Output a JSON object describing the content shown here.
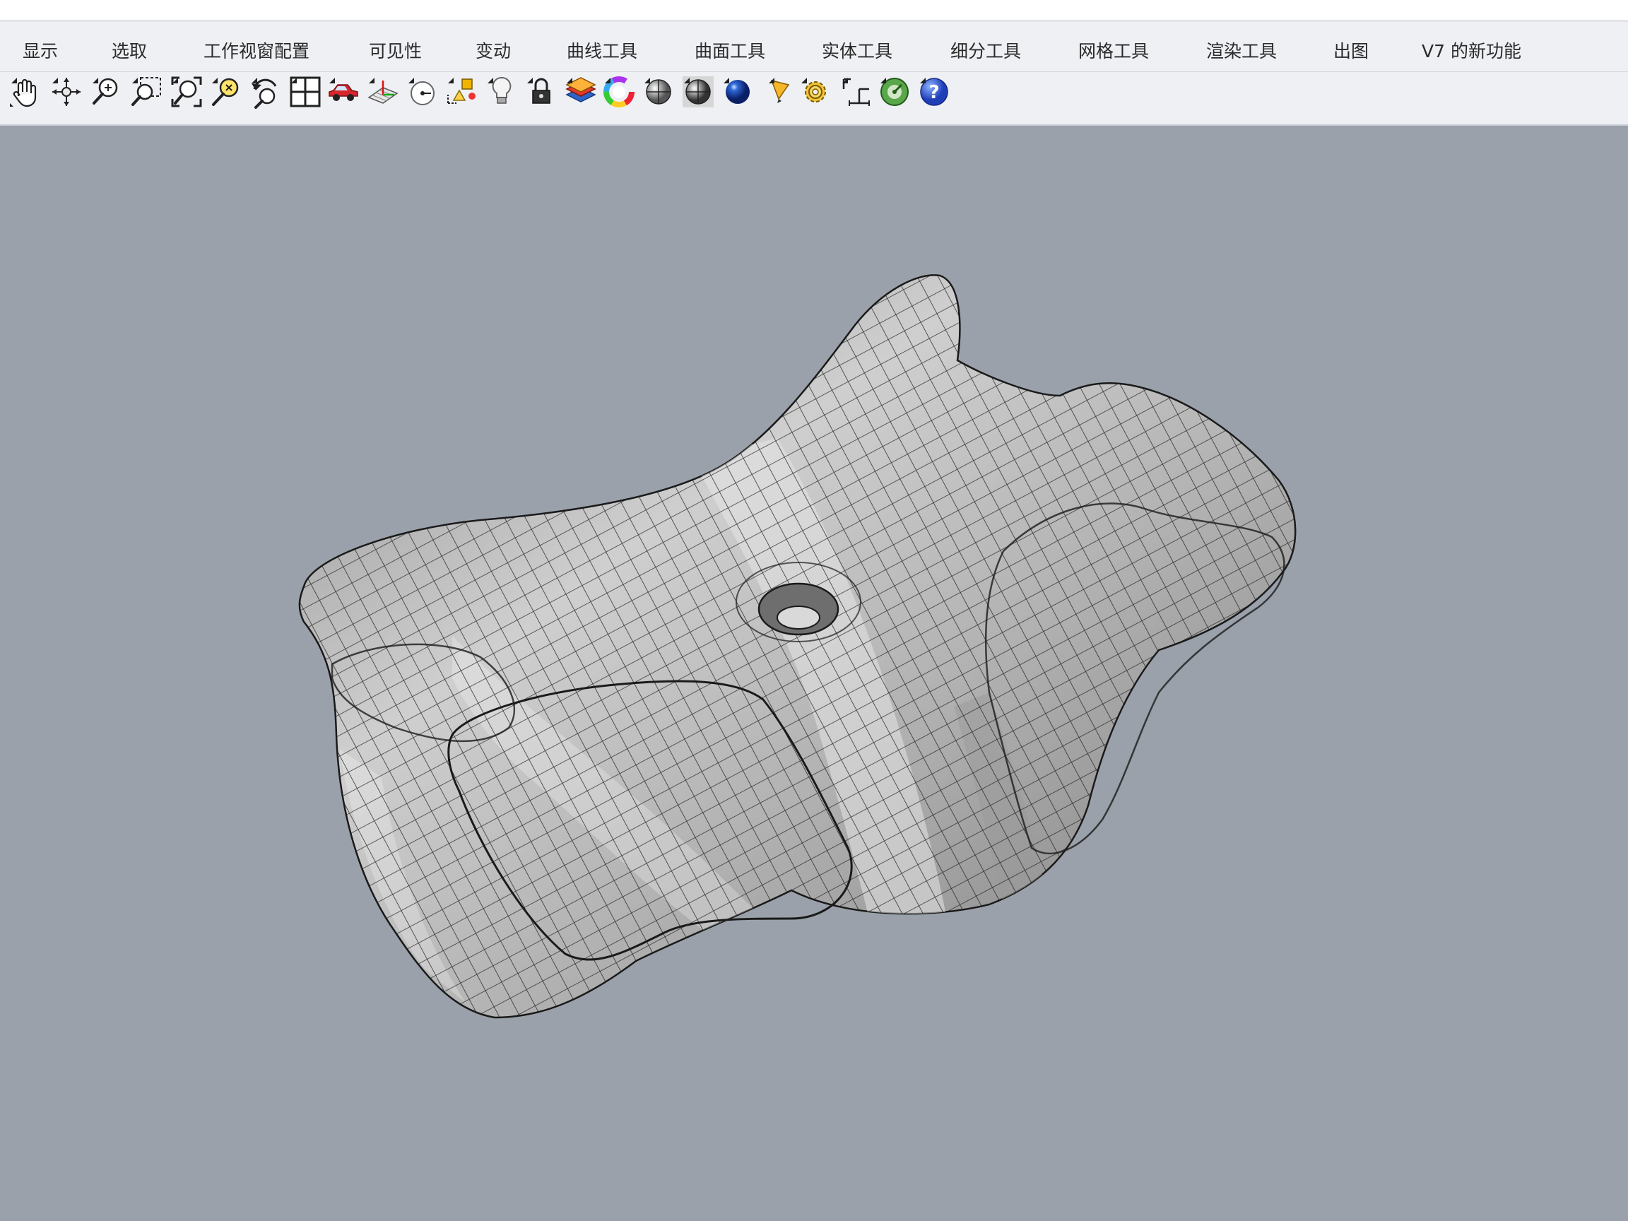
{
  "menu": {
    "items": [
      "显示",
      "选取",
      "工作视窗配置",
      "可见性",
      "变动",
      "曲线工具",
      "曲面工具",
      "实体工具",
      "细分工具",
      "网格工具",
      "渲染工具",
      "出图",
      "V7 的新功能"
    ]
  },
  "toolbar": {
    "icons": [
      "pan-hand-icon",
      "rotate-view-icon",
      "zoom-in-out-icon",
      "zoom-window-icon",
      "zoom-extents-icon",
      "zoom-selected-icon",
      "undo-view-icon",
      "four-viewports-icon",
      "named-view-car-icon",
      "named-cplane-icon",
      "cplane-origin-icon",
      "show-objects-icon",
      "light-bulb-icon",
      "lock-icon",
      "layer-icon",
      "color-wheel-icon",
      "shaded-sphere-icon",
      "rendered-sphere-icon",
      "blue-sphere-icon",
      "pencil-icon",
      "options-gear-icon",
      "dimension-icon",
      "plugin-globe-icon",
      "help-icon"
    ]
  },
  "colors": {
    "viewport_background": "#9aa1aa",
    "menubar_background": "#eef0f4",
    "model_surface": "#c4c4c4",
    "model_wire": "#1a1a1a"
  }
}
